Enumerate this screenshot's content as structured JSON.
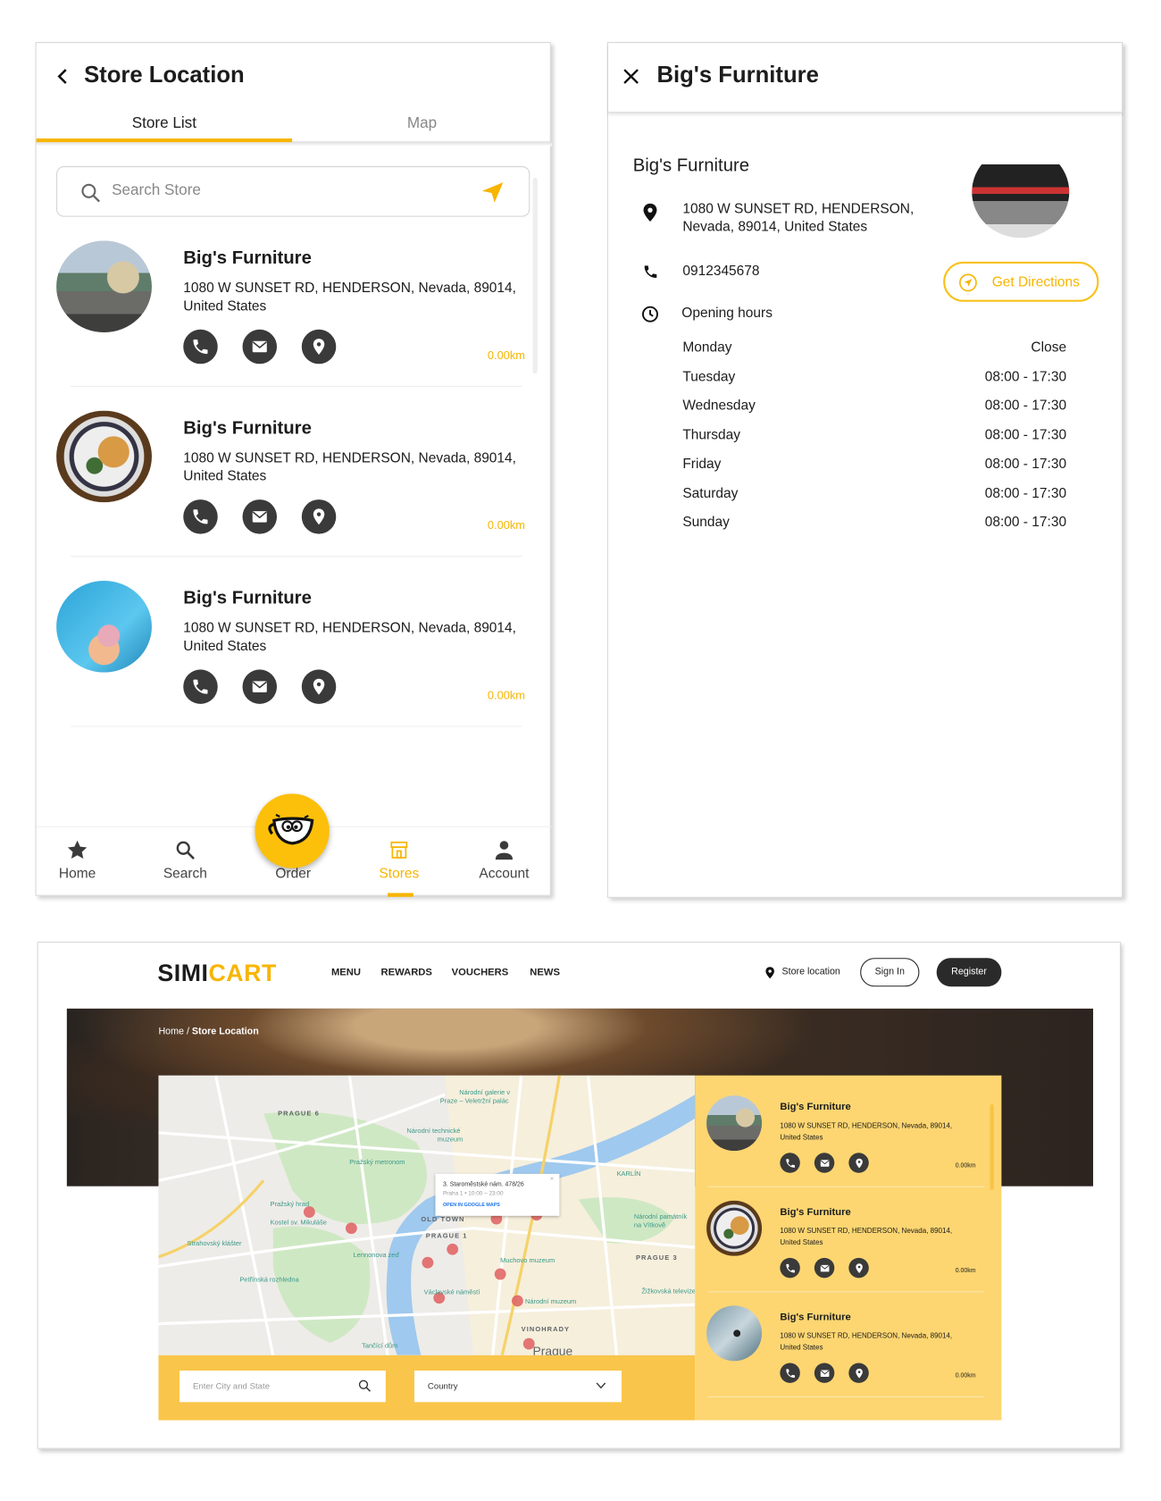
{
  "colors": {
    "accent": "#f7b500",
    "yellow_panel": "#fdd672",
    "yellow_bar": "#f9c54a",
    "icon_dark": "#3a3a3a"
  },
  "store_list_screen": {
    "title": "Store Location",
    "back_icon": "chevron-left-icon",
    "tabs": [
      {
        "label": "Store List",
        "active": true
      },
      {
        "label": "Map",
        "active": false
      }
    ],
    "search": {
      "placeholder": "Search Store",
      "icon": "search-icon",
      "locate_icon": "send-arrow-icon"
    },
    "stores": [
      {
        "name": "Big's Furniture",
        "address_line1": "1080 W SUNSET RD, HENDERSON, Nevada, 89014,",
        "address_line2": "United States",
        "distance": "0.00km"
      },
      {
        "name": "Big's Furniture",
        "address_line1": "1080 W SUNSET RD, HENDERSON, Nevada, 89014,",
        "address_line2": "United States",
        "distance": "0.00km"
      },
      {
        "name": "Big's Furniture",
        "address_line1": "1080 W SUNSET RD, HENDERSON, Nevada, 89014,",
        "address_line2": "United States",
        "distance": "0.00km"
      }
    ],
    "bottom_nav": [
      {
        "label": "Home",
        "icon": "star-icon",
        "active": false
      },
      {
        "label": "Search",
        "icon": "search-icon",
        "active": false
      },
      {
        "label": "Order",
        "icon": "coffee-cup-mascot-icon",
        "active": false
      },
      {
        "label": "Stores",
        "icon": "storefront-icon",
        "active": true
      },
      {
        "label": "Account",
        "icon": "person-icon",
        "active": false
      }
    ]
  },
  "store_detail_screen": {
    "title": "Big's Furniture",
    "close_icon": "close-icon",
    "name": "Big's Furniture",
    "address_line1": "1080 W SUNSET RD, HENDERSON,",
    "address_line2": "Nevada, 89014, United States",
    "phone": "0912345678",
    "directions_label": "Get Directions",
    "opening_hours_label": "Opening hours",
    "hours": [
      {
        "day": "Monday",
        "time": "Close"
      },
      {
        "day": "Tuesday",
        "time": "08:00 - 17:30"
      },
      {
        "day": "Wednesday",
        "time": "08:00 - 17:30"
      },
      {
        "day": "Thursday",
        "time": "08:00 - 17:30"
      },
      {
        "day": "Friday",
        "time": "08:00 - 17:30"
      },
      {
        "day": "Saturday",
        "time": "08:00 - 17:30"
      },
      {
        "day": "Sunday",
        "time": "08:00 - 17:30"
      }
    ]
  },
  "web": {
    "logo": {
      "part1": "SIMI",
      "part2": "CART"
    },
    "nav": [
      "MENU",
      "REWARDS",
      "VOUCHERS",
      "NEWS"
    ],
    "store_location_link": "Store location",
    "sign_in": "Sign In",
    "register": "Register",
    "breadcrumb": {
      "home": "Home",
      "separator": " / ",
      "current": "Store Location"
    },
    "map": {
      "labels": [
        "PRAGUE 6",
        "Národní galerie v",
        "Praze – Veletržní palác",
        "Národní technické",
        "muzeum",
        "Pražský metronom",
        "KARLÍN",
        "Pražský hrad",
        "Kostel sv. Mikuláše",
        "Strahovský klášter",
        "OLD TOWN",
        "PRAGUE 1",
        "Lennonova zeď",
        "Muchovo muzeum",
        "Národní památník",
        "na Vítkově",
        "PRAGUE 3",
        "Petřínská rozhledna",
        "Václavské náměstí",
        "Národní muzeum",
        "Žižkovská televize",
        "VINOHRADY",
        "Tančící dům",
        "Prague"
      ],
      "popup": {
        "title": "3. Staroměstské nám. 478/26",
        "subtitle": "Praha 1  •  10:00 – 23:00",
        "link": "OPEN IN GOOGLE MAPS"
      }
    },
    "city_input_placeholder": "Enter City and State",
    "country_select": "Country",
    "stores": [
      {
        "name": "Big's Furniture",
        "address_line1": "1080 W SUNSET RD, HENDERSON, Nevada, 89014,",
        "address_line2": "United States",
        "distance": "0.00km"
      },
      {
        "name": "Big's Furniture",
        "address_line1": "1080 W SUNSET RD, HENDERSON, Nevada, 89014,",
        "address_line2": "United States",
        "distance": "0.00km"
      },
      {
        "name": "Big's Furniture",
        "address_line1": "1080 W SUNSET RD, HENDERSON, Nevada, 89014,",
        "address_line2": "United States",
        "distance": "0.00km"
      }
    ]
  }
}
